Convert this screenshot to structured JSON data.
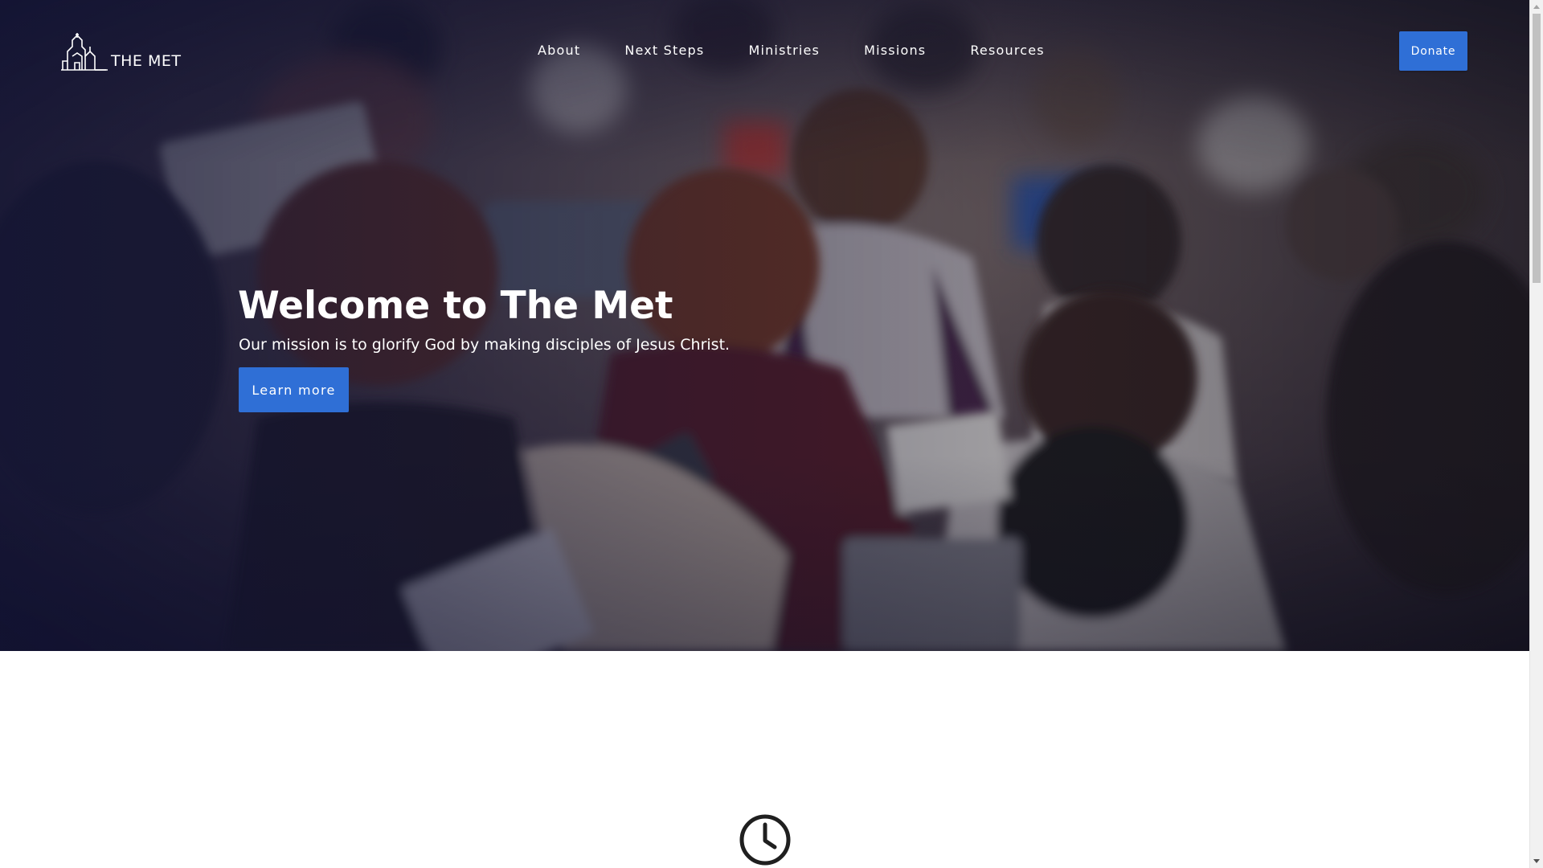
{
  "brand": {
    "name": "THE MET",
    "logo_icon": "church-skyline-icon"
  },
  "nav": {
    "items": [
      {
        "label": "About"
      },
      {
        "label": "Next Steps"
      },
      {
        "label": "Ministries"
      },
      {
        "label": "Missions"
      },
      {
        "label": "Resources"
      }
    ],
    "donate_label": "Donate"
  },
  "hero": {
    "title": "Welcome to The Met",
    "subtitle": "Our mission is to glorify God by making disciples of Jesus Christ.",
    "cta_label": "Learn more",
    "background_icon": "congregation-photo"
  },
  "next_section": {
    "icon": "clock-icon"
  },
  "colors": {
    "accent": "#2f6fd6",
    "hero_overlay": "#141634",
    "text_on_dark": "#ffffff",
    "icon_dark": "#1f1f1f"
  }
}
